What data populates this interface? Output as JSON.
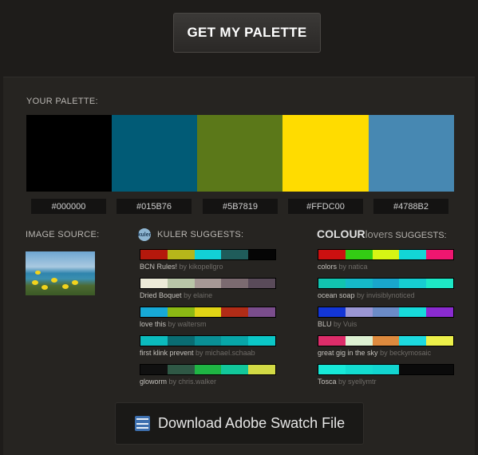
{
  "get_button": {
    "label": "GET MY PALETTE"
  },
  "palette": {
    "label": "YOUR PALETTE:",
    "swatches": [
      {
        "hex": "#000000",
        "color": "#000000"
      },
      {
        "hex": "#015B76",
        "color": "#015B76"
      },
      {
        "hex": "#5B7819",
        "color": "#5B7819"
      },
      {
        "hex": "#FFDC00",
        "color": "#FFDC00"
      },
      {
        "hex": "#4788B2",
        "color": "#4788B2"
      }
    ]
  },
  "image_source": {
    "label": "IMAGE SOURCE:"
  },
  "kuler": {
    "icon_text": "kuler",
    "label": "KULER SUGGESTS:",
    "items": [
      {
        "name": "BCN Rules!",
        "by": "by kikopellgro",
        "colors": [
          "#b5180c",
          "#b6b61a",
          "#12d0d6",
          "#1f5c5a",
          "#050505"
        ]
      },
      {
        "name": "Dried Boquet",
        "by": "by elaine",
        "colors": [
          "#ecead8",
          "#b9c6a8",
          "#a69895",
          "#7b6a70",
          "#594a59"
        ]
      },
      {
        "name": "love this",
        "by": "by waltersm",
        "colors": [
          "#17a9d6",
          "#8bb914",
          "#e1d515",
          "#b12c17",
          "#7a4d8c"
        ]
      },
      {
        "name": "first klink prevent",
        "by": "by michael.schaab",
        "colors": [
          "#0bbcbe",
          "#0a6c72",
          "#0a8f95",
          "#08a6a8",
          "#0bc7c7"
        ]
      },
      {
        "name": "gloworm",
        "by": "by chris.walker",
        "colors": [
          "#101010",
          "#2f5845",
          "#1fb544",
          "#12c89b",
          "#d2da45"
        ]
      }
    ]
  },
  "colourlovers": {
    "brand_bold": "COLOUR",
    "brand_light": "lovers",
    "suffix": " SUGGESTS:",
    "items": [
      {
        "name": "colors",
        "by": "by natica",
        "colors": [
          "#cc1010",
          "#33cc14",
          "#d6f514",
          "#12d6d6",
          "#ee1670"
        ]
      },
      {
        "name": "ocean soap",
        "by": "by invisiblynoticed",
        "colors": [
          "#11c4b0",
          "#15b9c9",
          "#19a6cc",
          "#16cdd1",
          "#1de8c6"
        ]
      },
      {
        "name": "BLU",
        "by": "by Vuis",
        "colors": [
          "#1336d6",
          "#9a96d4",
          "#6b8bc7",
          "#17dada",
          "#8a2bd0"
        ]
      },
      {
        "name": "great gig in the sky",
        "by": "by beckymosaic",
        "colors": [
          "#dd2d6a",
          "#ddf1d2",
          "#dd8a3e",
          "#1ddadf",
          "#ecf04a"
        ]
      },
      {
        "name": "Tosca",
        "by": "by syellymtr",
        "colors": [
          "#17e9d8",
          "#13dcd0",
          "#12d5d0",
          "#0a0a0a",
          "#0a0a0a"
        ]
      }
    ]
  },
  "download": {
    "label": "Download Adobe Swatch File"
  }
}
